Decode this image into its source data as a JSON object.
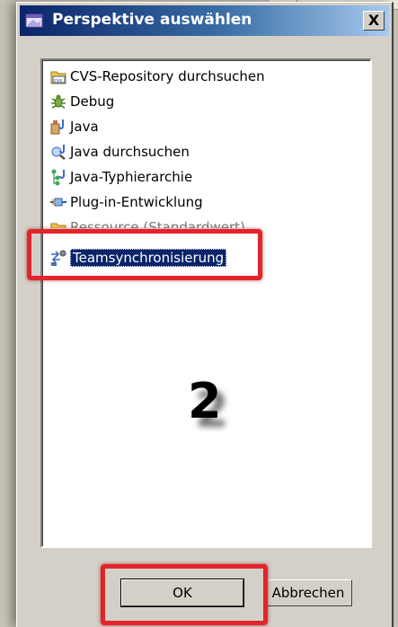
{
  "dialog": {
    "title": "Perspektive auswählen",
    "close_glyph": "X",
    "accent_color": "#0a246a",
    "highlight_color": "#e3242b"
  },
  "perspectives": [
    {
      "label": "CVS-Repository durchsuchen",
      "icon": "cvs-repository-icon"
    },
    {
      "label": "Debug",
      "icon": "debug-bug-icon"
    },
    {
      "label": "Java",
      "icon": "java-perspective-icon"
    },
    {
      "label": "Java durchsuchen",
      "icon": "java-browse-icon"
    },
    {
      "label": "Java-Typhierarchie",
      "icon": "type-hierarchy-icon"
    },
    {
      "label": "Plug-in-Entwicklung",
      "icon": "plugin-icon"
    },
    {
      "label": "Ressource (Standardwert)",
      "icon": "resource-folder-icon"
    },
    {
      "label": "Teamsynchronisierung",
      "icon": "team-sync-icon",
      "selected": true
    }
  ],
  "annotation": {
    "step_number": "2"
  },
  "buttons": {
    "ok_label": "OK",
    "cancel_label": "Abbrechen"
  }
}
